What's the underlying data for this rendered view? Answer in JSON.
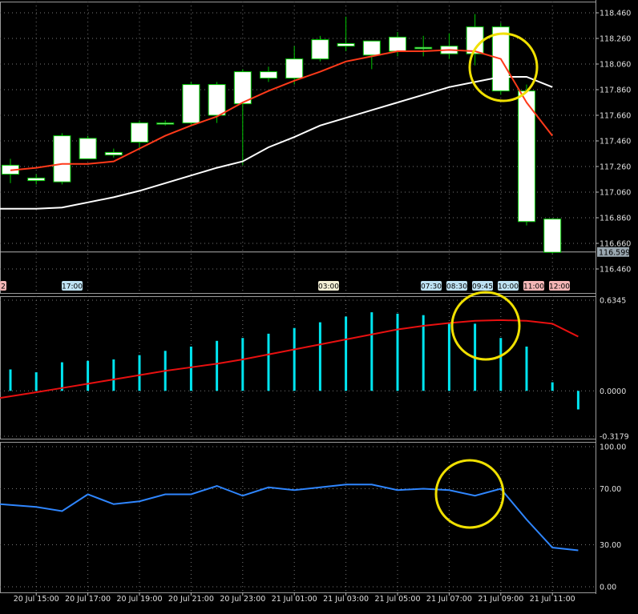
{
  "chart_data": [
    {
      "type": "candlestick",
      "title": "",
      "x": [
        "20 Jul 14:00",
        "20 Jul 15:00",
        "20 Jul 16:00",
        "20 Jul 17:00",
        "20 Jul 18:00",
        "20 Jul 19:00",
        "20 Jul 20:00",
        "20 Jul 21:00",
        "20 Jul 22:00",
        "20 Jul 23:00",
        "21 Jul 00:00",
        "21 Jul 01:00",
        "21 Jul 02:00",
        "21 Jul 03:00",
        "21 Jul 04:00",
        "21 Jul 05:00",
        "21 Jul 06:00",
        "21 Jul 07:00",
        "21 Jul 08:00",
        "21 Jul 09:00",
        "21 Jul 10:00",
        "21 Jul 11:00"
      ],
      "ohlc": [
        [
          117.2,
          117.32,
          117.13,
          117.27
        ],
        [
          117.17,
          117.2,
          117.12,
          117.15
        ],
        [
          117.14,
          117.52,
          117.12,
          117.5
        ],
        [
          117.48,
          117.5,
          117.32,
          117.32
        ],
        [
          117.37,
          117.4,
          117.33,
          117.35
        ],
        [
          117.45,
          117.62,
          117.4,
          117.6
        ],
        [
          117.6,
          117.62,
          117.58,
          117.6
        ],
        [
          117.6,
          117.92,
          117.58,
          117.9
        ],
        [
          117.9,
          117.92,
          117.6,
          117.66
        ],
        [
          117.75,
          118.02,
          117.27,
          118.0
        ],
        [
          118.0,
          118.04,
          117.92,
          117.95
        ],
        [
          117.95,
          118.2,
          117.9,
          118.1
        ],
        [
          118.1,
          118.28,
          118.08,
          118.25
        ],
        [
          118.22,
          118.43,
          118.16,
          118.2
        ],
        [
          118.13,
          118.24,
          118.02,
          118.24
        ],
        [
          118.16,
          118.31,
          118.12,
          118.27
        ],
        [
          118.18,
          118.28,
          118.12,
          118.19
        ],
        [
          118.14,
          118.3,
          118.1,
          118.2
        ],
        [
          118.14,
          118.45,
          118.05,
          118.35
        ],
        [
          118.35,
          118.38,
          117.82,
          117.85
        ],
        [
          117.85,
          117.9,
          116.8,
          116.83
        ],
        [
          116.85,
          116.85,
          116.58,
          116.59
        ]
      ],
      "series": [
        {
          "values": [
            117.23,
            117.25,
            117.28,
            117.28,
            117.3,
            117.4,
            117.5,
            117.58,
            117.65,
            117.76,
            117.85,
            117.93,
            118.0,
            118.08,
            118.12,
            118.16,
            118.16,
            118.17,
            118.16,
            118.1,
            117.76,
            117.5
          ]
        },
        {
          "values": [
            null,
            116.93,
            116.94,
            116.98,
            117.02,
            117.07,
            117.13,
            117.19,
            117.25,
            117.3,
            117.41,
            117.49,
            117.58,
            117.64,
            117.7,
            117.76,
            117.82,
            117.88,
            117.92,
            117.96,
            117.96,
            117.88
          ]
        }
      ],
      "ylim": [
        116.4,
        118.5
      ],
      "yticks": [
        "118.460",
        "118.260",
        "118.060",
        "117.860",
        "117.660",
        "117.460",
        "117.260",
        "117.060",
        "116.860",
        "116.660",
        "116.460"
      ],
      "current_price": "116.599",
      "time_markers": [
        {
          "label": "2",
          "color": "#f4b6b6"
        },
        {
          "label": "17:00",
          "color": "#bfe3f4"
        },
        {
          "label": "03:00",
          "color": "#f4f0d6"
        },
        {
          "label": "07:30",
          "color": "#bfe3f4"
        },
        {
          "label": "08:30",
          "color": "#bfe3f4"
        },
        {
          "label": "09:45",
          "color": "#bfe3f4"
        },
        {
          "label": "10:00",
          "color": "#bfe3f4"
        },
        {
          "label": "11:00",
          "color": "#f4b6b6"
        },
        {
          "label": "12:00",
          "color": "#f4b6b6"
        }
      ],
      "colors": {
        "candle_body": "#ffffff",
        "candle_outline": "#00c800",
        "fast_ma": "#ff3a1a",
        "slow_ma": "#ffffff",
        "highlight": "#f0e000"
      }
    },
    {
      "type": "bar",
      "title": "",
      "values": [
        0.15,
        0.13,
        0.2,
        0.21,
        0.22,
        0.25,
        0.28,
        0.31,
        0.35,
        0.37,
        0.4,
        0.44,
        0.48,
        0.52,
        0.55,
        0.54,
        0.53,
        0.48,
        0.47,
        0.37,
        0.31,
        0.06,
        -0.13
      ],
      "series": [
        {
          "values": [
            -0.05,
            -0.01,
            0.02,
            0.05,
            0.08,
            0.11,
            0.14,
            0.165,
            0.19,
            0.22,
            0.255,
            0.29,
            0.325,
            0.36,
            0.395,
            0.43,
            0.455,
            0.475,
            0.49,
            0.495,
            0.49,
            0.47,
            0.38
          ]
        }
      ],
      "ylim": [
        -0.3179,
        0.6345
      ],
      "yticks": [
        "0.6345",
        "0.0000",
        "-0.3179"
      ],
      "colors": {
        "bar": "#00e5f0",
        "signal": "#e81010",
        "highlight": "#f0e000"
      }
    },
    {
      "type": "line",
      "title": "",
      "series": [
        {
          "values": [
            59,
            57,
            54,
            66,
            59,
            61,
            66,
            66,
            72,
            65,
            71,
            69,
            71,
            73,
            73,
            69,
            70,
            69,
            65,
            70,
            48,
            28,
            26
          ]
        }
      ],
      "ylim": [
        0,
        100
      ],
      "yticks": [
        "100.00",
        "70.00",
        "30.00",
        "0.00"
      ],
      "xticks": [
        "20 Jul 15:00",
        "20 Jul 17:00",
        "20 Jul 19:00",
        "20 Jul 21:00",
        "20 Jul 23:00",
        "21 Jul 01:00",
        "21 Jul 03:00",
        "21 Jul 05:00",
        "21 Jul 07:00",
        "21 Jul 09:00",
        "21 Jul 11:00"
      ],
      "colors": {
        "line": "#2f86ff",
        "highlight": "#f0e000"
      }
    }
  ]
}
